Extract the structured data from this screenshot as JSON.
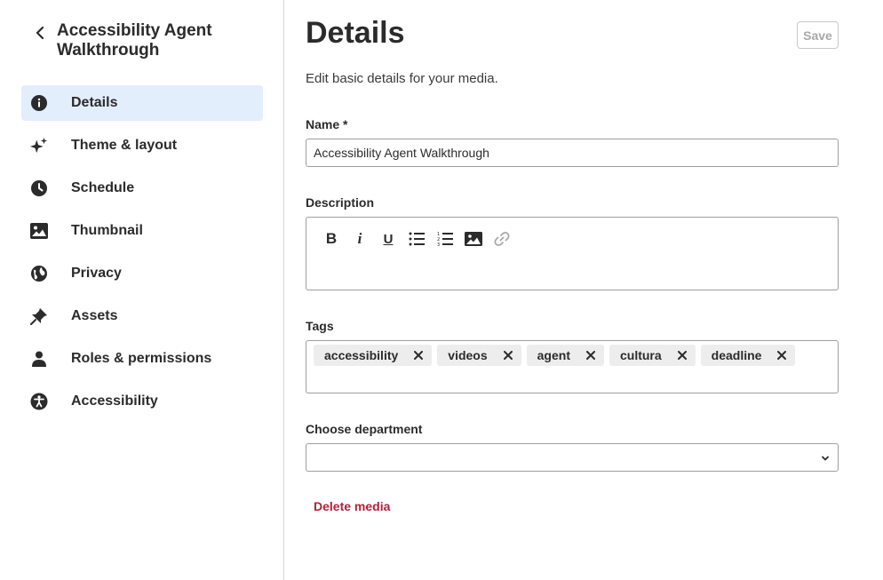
{
  "sidebar": {
    "media_title": "Accessibility Agent Walkthrough",
    "back_icon": "chevron-left-icon",
    "items": [
      {
        "label": "Details",
        "icon": "info-icon",
        "active": true
      },
      {
        "label": "Theme & layout",
        "icon": "sparkles-icon",
        "active": false
      },
      {
        "label": "Schedule",
        "icon": "clock-icon",
        "active": false
      },
      {
        "label": "Thumbnail",
        "icon": "image-icon",
        "active": false
      },
      {
        "label": "Privacy",
        "icon": "globe-icon",
        "active": false
      },
      {
        "label": "Assets",
        "icon": "pin-icon",
        "active": false
      },
      {
        "label": "Roles & permissions",
        "icon": "person-icon",
        "active": false
      },
      {
        "label": "Accessibility",
        "icon": "accessibility-icon",
        "active": false
      }
    ]
  },
  "main": {
    "title": "Details",
    "save_label": "Save",
    "subtitle": "Edit basic details for your media.",
    "name_label": "Name *",
    "name_value": "Accessibility Agent Walkthrough",
    "description_label": "Description",
    "toolbar": {
      "bold": "B",
      "italic": "i",
      "underline": "U",
      "icons": [
        "bold-icon",
        "italic-icon",
        "underline-icon",
        "bulleted-list-icon",
        "numbered-list-icon",
        "insert-image-icon",
        "link-icon"
      ]
    },
    "tags_label": "Tags",
    "tags": [
      "accessibility",
      "videos",
      "agent",
      "cultura",
      "deadline"
    ],
    "department_label": "Choose department",
    "department_value": "",
    "delete_label": "Delete media"
  },
  "colors": {
    "active_bg": "#e2eefc",
    "danger": "#b3203a",
    "border": "#9e9e9e",
    "tag_bg": "#ededed"
  }
}
